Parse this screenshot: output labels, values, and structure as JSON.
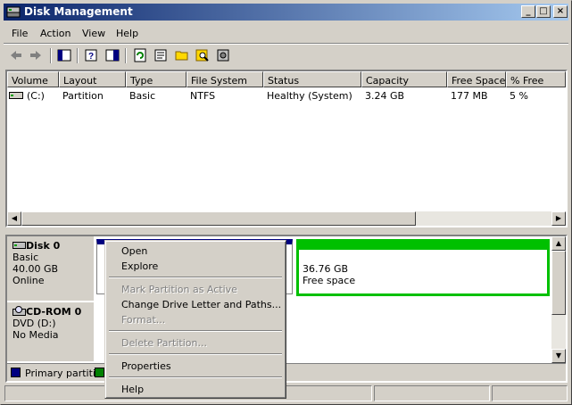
{
  "window": {
    "title": "Disk Management",
    "buttons": {
      "minimize": "_",
      "maximize": "□",
      "close": "×"
    }
  },
  "menubar": [
    {
      "label": "File"
    },
    {
      "label": "Action"
    },
    {
      "label": "View"
    },
    {
      "label": "Help"
    }
  ],
  "toolbar": {
    "icons": [
      "back-arrow-icon",
      "forward-arrow-icon",
      "show-hide-console-tree-icon",
      "help-icon",
      "properties-pane-icon",
      "refresh-icon",
      "properties-icon",
      "open-folder-icon",
      "search-icon",
      "settings-icon"
    ]
  },
  "volume_list": {
    "columns": [
      "Volume",
      "Layout",
      "Type",
      "File System",
      "Status",
      "Capacity",
      "Free Space",
      "% Free"
    ],
    "rows": [
      {
        "volume": "(C:)",
        "layout": "Partition",
        "type": "Basic",
        "file_system": "NTFS",
        "status": "Healthy (System)",
        "capacity": "3.24 GB",
        "free_space": "177 MB",
        "pct_free": "5 %"
      }
    ]
  },
  "disks": [
    {
      "name": "Disk 0",
      "type": "Basic",
      "size": "40.00 GB",
      "state": "Online"
    },
    {
      "name": "CD-ROM 0",
      "type": "DVD (D:)",
      "size": "",
      "state": "No Media"
    }
  ],
  "free_partition": {
    "size": "36.76 GB",
    "label": "Free space"
  },
  "legend": [
    {
      "label": "Primary partition",
      "color": "#000080"
    },
    {
      "label": "",
      "color": "#008000"
    }
  ],
  "context_menu": {
    "items": [
      {
        "label": "Open",
        "enabled": true
      },
      {
        "label": "Explore",
        "enabled": true
      },
      {
        "label": "Mark Partition as Active",
        "enabled": false
      },
      {
        "label": "Change Drive Letter and Paths...",
        "enabled": true
      },
      {
        "label": "Format...",
        "enabled": false
      },
      {
        "label": "Delete Partition...",
        "enabled": false
      },
      {
        "label": "Properties",
        "enabled": true
      },
      {
        "label": "Help",
        "enabled": true
      }
    ]
  },
  "colors": {
    "title_start": "#0a246a",
    "title_end": "#a6caf0",
    "primary": "#000080",
    "free": "#00c000",
    "face": "#d4d0c8"
  }
}
